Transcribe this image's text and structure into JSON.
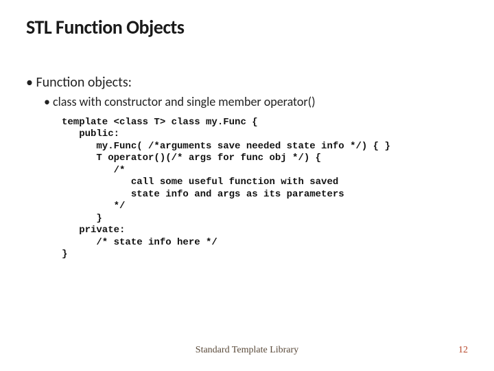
{
  "title": "STL Function Objects",
  "bullets": {
    "lvl1": "Function objects:",
    "lvl2": "class with constructor and single member operator()"
  },
  "code": "template <class T> class my.Func {\n   public:\n      my.Func( /*arguments save needed state info */) { }\n      T operator()(/* args for func obj */) {\n         /*\n            call some useful function with saved\n            state info and args as its parameters\n         */\n      }\n   private:\n      /* state info here */\n}",
  "footer": "Standard Template Library",
  "page": "12"
}
